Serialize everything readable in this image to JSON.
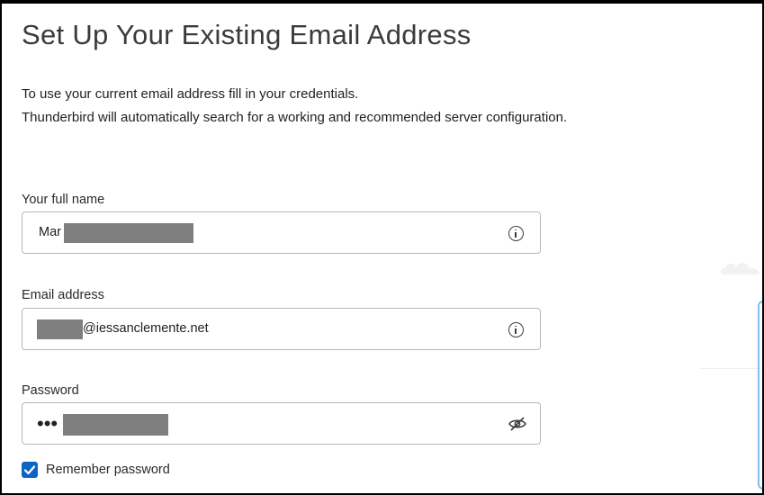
{
  "page": {
    "title": "Set Up Your Existing Email Address",
    "intro_line1": "To use your current email address fill in your credentials.",
    "intro_line2": "Thunderbird will automatically search for a working and recommended server configuration."
  },
  "form": {
    "full_name": {
      "label": "Your full name",
      "value": "Mar",
      "info_icon": "info-icon"
    },
    "email": {
      "label": "Email address",
      "value": "@iessanclemente.net",
      "info_icon": "info-icon"
    },
    "password": {
      "label": "Password",
      "value": "•••",
      "toggle_icon": "eye-slash-icon"
    },
    "remember": {
      "label": "Remember password",
      "checked": true
    }
  },
  "colors": {
    "accent": "#0b65c2",
    "text": "#3b3b3b",
    "border": "#b7b7b7",
    "redaction": "#7f7f7f"
  }
}
